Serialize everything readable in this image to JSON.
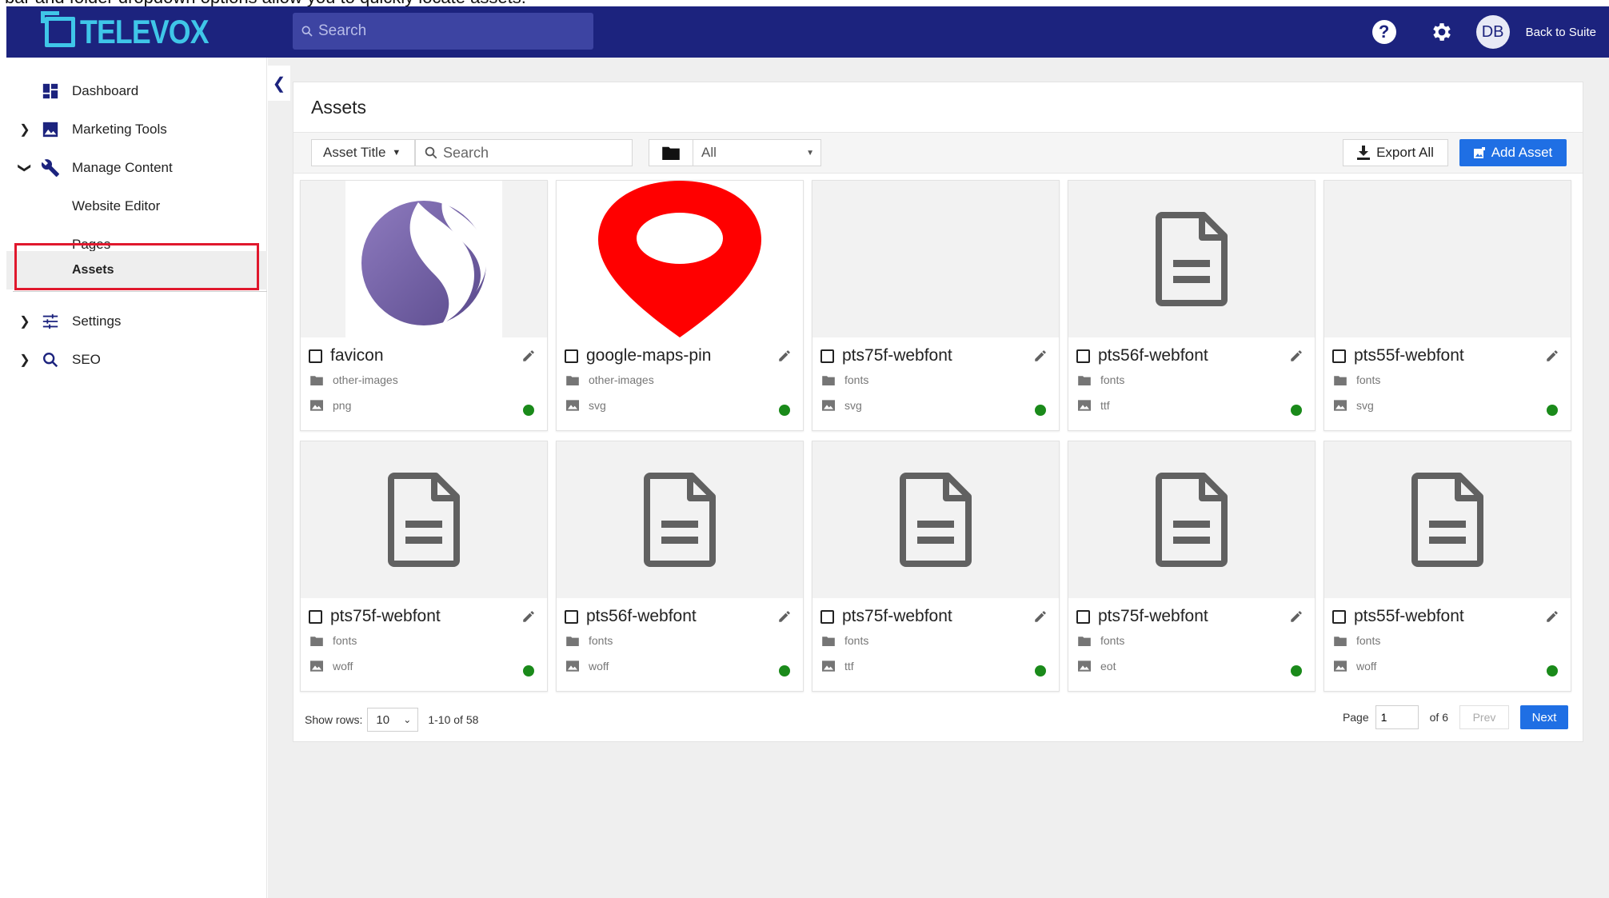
{
  "caption": "bar and folder dropdown options allow you to quickly locate assets.",
  "header": {
    "logo_text": "TELEVOX",
    "search_placeholder": "Search",
    "help_glyph": "?",
    "avatar_initials": "DB",
    "back_link": "Back to Suite"
  },
  "sidebar": {
    "items": [
      {
        "label": "Dashboard",
        "icon": "dashboard-icon"
      },
      {
        "label": "Marketing Tools",
        "icon": "image-icon"
      },
      {
        "label": "Manage Content",
        "icon": "wrench-icon"
      },
      {
        "label": "Website Editor"
      },
      {
        "label": "Pages"
      },
      {
        "label": "Assets"
      },
      {
        "label": "Settings",
        "icon": "sliders-icon"
      },
      {
        "label": "SEO",
        "icon": "search-icon"
      }
    ]
  },
  "panel": {
    "title": "Assets",
    "filter_field": "Asset Title",
    "search_placeholder": "Search",
    "folder_value": "All",
    "export_label": "Export All",
    "add_label": "Add Asset"
  },
  "assets": [
    {
      "name": "favicon",
      "folder": "other-images",
      "type": "png",
      "thumb": "favicon"
    },
    {
      "name": "google-maps-pin",
      "folder": "other-images",
      "type": "svg",
      "thumb": "pin"
    },
    {
      "name": "pts75f-webfont",
      "folder": "fonts",
      "type": "svg",
      "thumb": "blank"
    },
    {
      "name": "pts56f-webfont",
      "folder": "fonts",
      "type": "ttf",
      "thumb": "doc"
    },
    {
      "name": "pts55f-webfont",
      "folder": "fonts",
      "type": "svg",
      "thumb": "blank"
    },
    {
      "name": "pts75f-webfont",
      "folder": "fonts",
      "type": "woff",
      "thumb": "doc"
    },
    {
      "name": "pts56f-webfont",
      "folder": "fonts",
      "type": "woff",
      "thumb": "doc"
    },
    {
      "name": "pts75f-webfont",
      "folder": "fonts",
      "type": "ttf",
      "thumb": "doc"
    },
    {
      "name": "pts75f-webfont",
      "folder": "fonts",
      "type": "eot",
      "thumb": "doc"
    },
    {
      "name": "pts55f-webfont",
      "folder": "fonts",
      "type": "woff",
      "thumb": "doc"
    }
  ],
  "pagination": {
    "show_rows_label": "Show rows:",
    "rows_value": "10",
    "range": "1-10 of 58",
    "page_label": "Page",
    "page_value": "1",
    "of_pages": "of 6",
    "prev_label": "Prev",
    "next_label": "Next"
  },
  "colors": {
    "header_bg": "#1c237e",
    "logo": "#3fc6e8",
    "primary_button": "#1f6fe4",
    "status_active": "#1a8a1a",
    "highlight": "#e0182d"
  }
}
